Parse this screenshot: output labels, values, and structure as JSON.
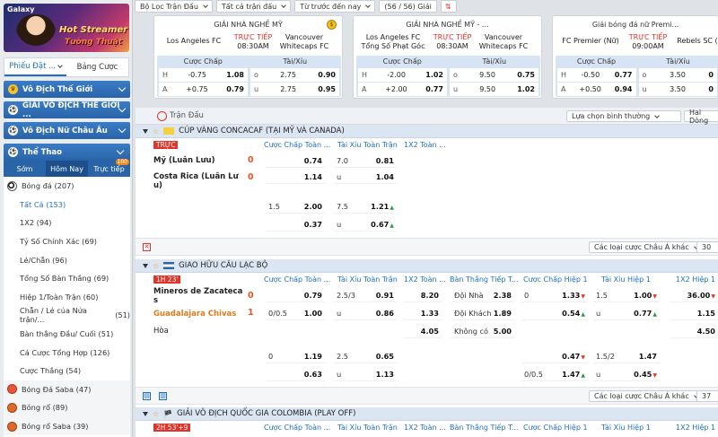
{
  "sidebar": {
    "banner": {
      "brand": "Galaxy",
      "title1": "Hot Streamer",
      "title2": "Tướng Thuật"
    },
    "tabs": [
      "Phiếu Đặt ...",
      "Bảng Cược"
    ],
    "categories": [
      "Vô Địch Thế Giới",
      "GIẢI VÔ ĐỊCH THẾ GIỚI ...",
      "Vô Địch Nữ Châu Âu"
    ],
    "sports_title": "Thể Thao",
    "sub_tabs": [
      "Sớm",
      "Hôm Nay",
      "Trực tiếp"
    ],
    "live_badge": "100",
    "items": [
      {
        "label": "Bóng đá",
        "count": "(207)"
      },
      {
        "label": "Tất Cả",
        "count": "(153)"
      },
      {
        "label": "1X2",
        "count": "(94)"
      },
      {
        "label": "Tỷ Số Chính Xác",
        "count": "(69)"
      },
      {
        "label": "Lẻ/Chẵn",
        "count": "(96)"
      },
      {
        "label": "Tổng Số Bàn Thắng",
        "count": "(69)"
      },
      {
        "label": "Hiệp 1/Toàn Trận",
        "count": "(60)"
      },
      {
        "label": "Chẵn / Lẻ của Nửa trận/...",
        "count": "(51)"
      },
      {
        "label": "Bàn thắng Đầu/ Cuối",
        "count": "(51)"
      },
      {
        "label": "Cá Cược Tổng Hợp",
        "count": "(126)"
      },
      {
        "label": "Cược Thắng",
        "count": "(54)"
      },
      {
        "label": "Bóng Đá Saba",
        "count": "(47)"
      },
      {
        "label": "Bóng rổ",
        "count": "(89)"
      },
      {
        "label": "Bóng rổ Saba",
        "count": "(39)"
      }
    ]
  },
  "topbar": {
    "filter": "Bộ Lọc Trận Đấu",
    "matches": "Tất cả trận đấu",
    "order": "Từ trước đến nay",
    "count": "(56 / 56) Giải"
  },
  "cards": [
    {
      "league": "GIẢI NHÀ NGHỀ MỸ",
      "home": "Los Angeles FC",
      "away": "Vancouver Whitecaps FC",
      "status": "TRỰC TIẾP",
      "time": "08:30AM",
      "h1": "Cược Chấp",
      "h2": "Tài/Xỉu",
      "rows": [
        {
          "a": "H",
          "b": "-0.75",
          "c": "1.08",
          "d": "o",
          "e": "2.75",
          "f": "0.90"
        },
        {
          "a": "A",
          "b": "+0.75",
          "c": "0.79",
          "d": "u",
          "e": "2.75",
          "f": "0.95"
        }
      ]
    },
    {
      "league": "GIẢI NHÀ NGHỀ MỸ - ...",
      "home": "Los Angeles FC Tổng Số Phạt Góc",
      "away": "Vancouver Whitecaps FC",
      "status": "TRỰC TIẾP",
      "time": "08:30AM",
      "h1": "Cược Chấp",
      "h2": "Tài/Xỉu",
      "rows": [
        {
          "a": "H",
          "b": "-2.00",
          "c": "1.02",
          "d": "o",
          "e": "9.50",
          "f": "0.75"
        },
        {
          "a": "A",
          "b": "+2.00",
          "c": "0.77",
          "d": "u",
          "e": "9.50",
          "f": "1.02"
        }
      ]
    },
    {
      "league": "Giải bóng đá nữ Premi...",
      "home": "FC Premier (Nữ)",
      "away": "Rebels SC (",
      "status": "TRỰC TIẾP",
      "time": "09:00AM",
      "h1": "Cược Chấp",
      "h2": "Tài/Xỉu",
      "rows": [
        {
          "a": "H",
          "b": "-0.50",
          "c": "0.77",
          "d": "o",
          "e": "3.50",
          "f": "0"
        },
        {
          "a": "A",
          "b": "+0.50",
          "c": "0.94",
          "d": "u",
          "e": "3.50",
          "f": "0"
        }
      ]
    }
  ],
  "main": {
    "header": "Trận Đấu",
    "sort": "Lựa chọn bình thường",
    "view": "Hai Dòng",
    "league1": {
      "name": "CÚP VÀNG CONCACAF (TẠI MỸ VÀ CANADA)",
      "tag": "TRỰC",
      "cols": [
        "Cược Chấp Toàn ...",
        "Tài Xỉu Toàn Trận",
        "1X2 Toàn ..."
      ],
      "home": "Mỹ (Luân Lưu)",
      "away": "Costa Rica (Luân Lư u)",
      "hs": "0",
      "as": "0",
      "r1": {
        "o1": "0.74",
        "tl": "7.0",
        "o2": "0.81"
      },
      "r2": {
        "o1": "1.14",
        "tl": "u",
        "o2": "1.04"
      },
      "r3": {
        "hl": "1.5",
        "o1": "2.00",
        "tl": "7.5",
        "o2": "1.21"
      },
      "r4": {
        "o1": "0.37",
        "tl": "u",
        "o2": "0.67"
      }
    },
    "footer1": {
      "sel": "Các loại cược Châu Á khác",
      "n": "30"
    },
    "league2": {
      "name": "GIAO HỮU CÂU LẠC BỘ",
      "tag": "1H  23'",
      "cols": [
        "Cược Chấp Toàn ...",
        "Tài Xỉu Toàn Trận",
        "1X2 Toàn ...",
        "Bàn Thắng Tiếp T...",
        "Cược Chấp Hiệp 1",
        "Tài Xỉu Hiệp 1",
        "1X2 Hiệp 1"
      ],
      "home": "Mineros de Zacateca s",
      "away": "Guadalajara Chivas",
      "draw": "Hòa",
      "hs": "0",
      "as": "1",
      "r1": {
        "o1": "0.79",
        "tl": "2.5/3",
        "o2": "0.91",
        "x": "8.20",
        "nl": "Đội Nhà",
        "nv": "2.38",
        "hh": "0",
        "ho": "1.33",
        "th": "1.5",
        "to": "1.00",
        "xh": "36.00"
      },
      "r2": {
        "hl": "0/0.5",
        "o1": "1.00",
        "tl": "u",
        "o2": "0.86",
        "x": "1.33",
        "nl": "Đội Khách",
        "nv": "1.89",
        "ho": "0.54",
        "tl2": "u",
        "to": "0.77",
        "xh": "1.15"
      },
      "r3": {
        "x": "4.05",
        "nl": "Không có",
        "nv": "5.00",
        "xh": "4.50"
      },
      "r4": {
        "hl": "0",
        "o1": "1.19",
        "tl": "2.5",
        "o2": "0.65",
        "ho": "0.47",
        "th": "1.5/2",
        "to": "1.47"
      },
      "r5": {
        "o1": "0.63",
        "tl": "u",
        "o2": "1.13",
        "hh": "0/0.5",
        "ho": "1.47",
        "tl2": "u",
        "to": "0.45"
      }
    },
    "footer2": {
      "sel": "Các loại cược Châu Á khác",
      "n": "37"
    },
    "league3": {
      "name": "GIẢI VÔ ĐỊCH QUỐC GIA COLOMBIA (PLAY OFF)",
      "tag": "2H  53'+9",
      "cols": [
        "Cược Chấp Toàn ...",
        "Tài Xỉu Toàn Trận",
        "1X2 Toàn ...",
        "Bàn Thắng Tiếp T...",
        "Cược Chấp Hiệp 1",
        "Tài Xỉu Hiệp 1",
        "1X2 Hiệp 1"
      ]
    }
  },
  "colors": {
    "accent": "#1f6fc0",
    "live": "#e0352b",
    "score": "#e0552b",
    "nav": "#2a64a8"
  }
}
